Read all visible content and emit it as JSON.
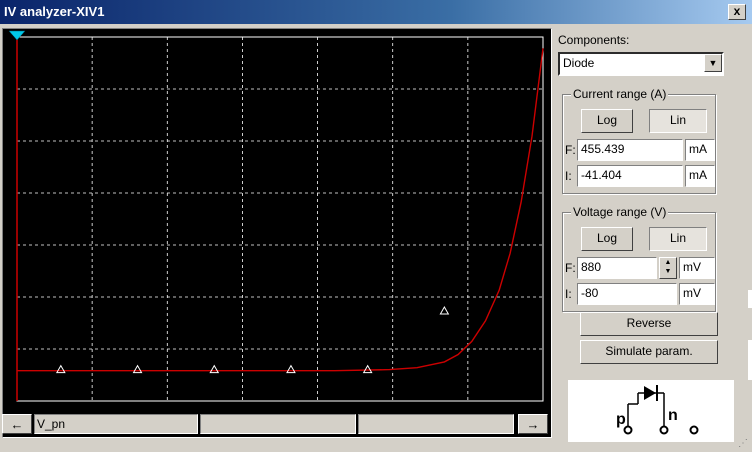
{
  "window": {
    "title": "IV analyzer-XIV1",
    "close_label": "x",
    "close_icon": "close-icon"
  },
  "components": {
    "label": "Components:",
    "selected": "Diode"
  },
  "current_range": {
    "title": "Current range (A)",
    "log_label": "Log",
    "lin_label": "Lin",
    "active": "Lin",
    "final_label": "F:",
    "final_value": "455.439",
    "final_unit": "mA",
    "initial_label": "I:",
    "initial_value": "-41.404",
    "initial_unit": "mA"
  },
  "voltage_range": {
    "title": "Voltage range (V)",
    "log_label": "Log",
    "lin_label": "Lin",
    "active": "Lin",
    "final_label": "F:",
    "final_value": "880",
    "final_unit": "mV",
    "initial_label": "I:",
    "initial_value": "-80",
    "initial_unit": "mV"
  },
  "buttons": {
    "reverse": "Reverse",
    "simulate": "Simulate param."
  },
  "symbol": {
    "p_label": "p",
    "n_label": "n"
  },
  "statusbar": {
    "left_arrow": "←",
    "right_arrow": "→",
    "trace_name": "V_pn"
  },
  "colors": {
    "plot_bg": "#000000",
    "grid": "#ffffff",
    "curve": "#cc0000",
    "cursor": "#00c8e8"
  },
  "chart_data": {
    "type": "line",
    "xlim": [
      -80,
      880
    ],
    "ylim": [
      -41.404,
      455.439
    ],
    "grid": true,
    "series": [
      {
        "x": [
          -80,
          -40,
          0,
          100,
          200,
          300,
          400,
          500,
          600,
          650,
          700,
          725,
          750,
          775,
          800,
          820,
          840,
          860,
          880
        ],
        "y": [
          0,
          0,
          0,
          0,
          0,
          0,
          0,
          0,
          1.5,
          4,
          12,
          22,
          40,
          68,
          110,
          160,
          230,
          320,
          440
        ]
      }
    ],
    "markers": [
      {
        "x": 0,
        "y": 0
      },
      {
        "x": 140,
        "y": 0
      },
      {
        "x": 280,
        "y": 0
      },
      {
        "x": 420,
        "y": 0
      },
      {
        "x": 560,
        "y": 0
      },
      {
        "x": 700,
        "y": 80
      }
    ],
    "cursor_x": -80
  }
}
